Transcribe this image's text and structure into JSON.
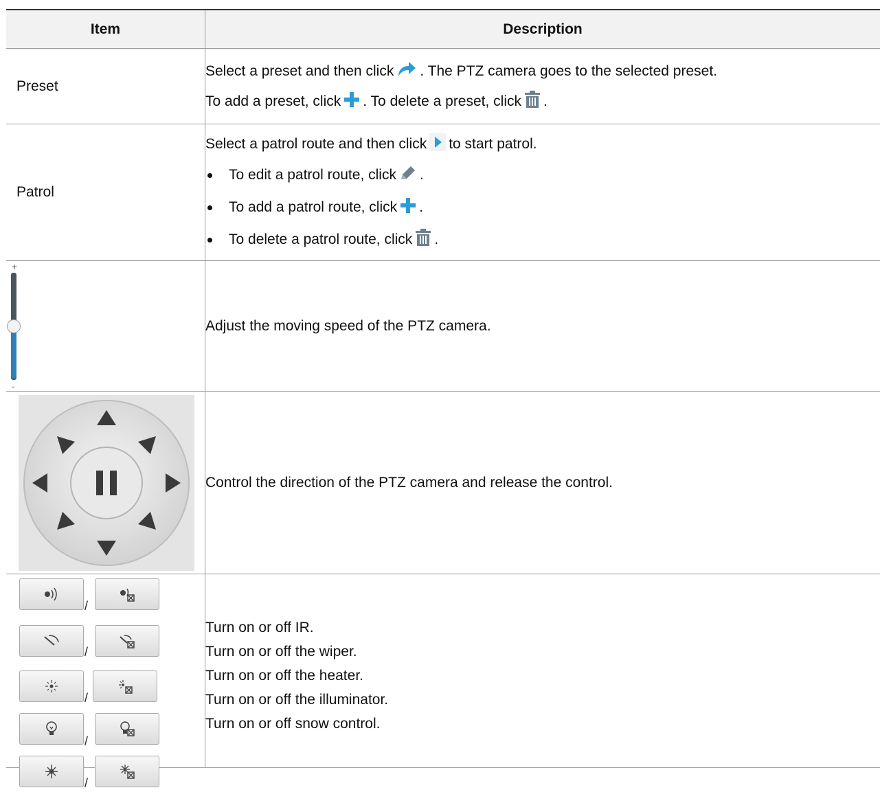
{
  "table": {
    "headers": {
      "item": "Item",
      "description": "Description"
    },
    "rows": {
      "preset": {
        "item": "Preset",
        "line1_pre": "Select a preset and then click",
        "line1_post": ". The PTZ camera goes to the selected preset.",
        "line2_pre": "To add a preset, click",
        "line2_mid": ". To delete a preset, click",
        "line2_post": "."
      },
      "patrol": {
        "item": "Patrol",
        "line1_pre": "Select a patrol route and then click",
        "line1_post": "to start patrol.",
        "bullets": [
          {
            "text": "To edit a patrol route, click",
            "end": "."
          },
          {
            "text": "To add a patrol route, click",
            "end": "."
          },
          {
            "text": "To delete a patrol route, click",
            "end": "."
          }
        ]
      },
      "speed": {
        "plus": "+",
        "minus": "-",
        "level": 0.5,
        "description": "Adjust the moving speed of the PTZ camera."
      },
      "direction": {
        "description": "Control the direction of the PTZ camera and release the control."
      },
      "toggles": {
        "separator": "/",
        "lines": [
          "Turn on or off IR.",
          "Turn on or off the wiper.",
          "Turn on or off the heater.",
          "Turn on or off the illuminator.",
          "Turn on or off snow control."
        ]
      }
    }
  },
  "colors": {
    "accent_blue": "#2d9bd6",
    "icon_gray": "#6e7f8d",
    "header_bg": "#f2f2f2",
    "border": "#9a9a9a"
  },
  "icons": {
    "goto": "redo-arrow-icon",
    "add": "plus-icon",
    "delete": "trash-icon",
    "start": "play-icon",
    "edit": "pencil-icon",
    "toggles": [
      "ir-on-icon",
      "ir-off-icon",
      "wiper-on-icon",
      "wiper-off-icon",
      "heater-on-icon",
      "heater-off-icon",
      "illuminator-on-icon",
      "illuminator-off-icon",
      "snow-on-icon",
      "snow-off-icon"
    ]
  }
}
